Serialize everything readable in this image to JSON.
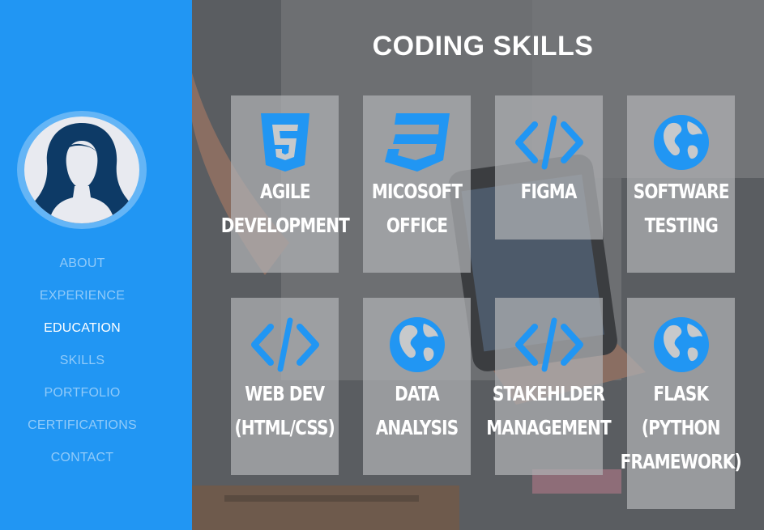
{
  "sidebar": {
    "avatar_alt": "profile avatar",
    "nav": [
      {
        "label": "ABOUT",
        "active": false
      },
      {
        "label": "EXPERIENCE",
        "active": false
      },
      {
        "label": "EDUCATION",
        "active": true
      },
      {
        "label": "SKILLS",
        "active": false
      },
      {
        "label": "PORTFOLIO",
        "active": false
      },
      {
        "label": "CERTIFICATIONS",
        "active": false
      },
      {
        "label": "CONTACT",
        "active": false
      }
    ]
  },
  "main": {
    "title": "CODING SKILLS",
    "skills": [
      {
        "label": "AGILE\nDEVELOPMENT",
        "icon": "html5-icon"
      },
      {
        "label": "MICOSOFT\nOFFICE",
        "icon": "css3-icon"
      },
      {
        "label": "FIGMA",
        "icon": "code-icon"
      },
      {
        "label": "SOFTWARE\nTESTING",
        "icon": "globe-icon"
      },
      {
        "label": "WEB DEV\n(HTML/CSS)",
        "icon": "code-icon"
      },
      {
        "label": "DATA\nANALYSIS",
        "icon": "globe-icon"
      },
      {
        "label": "STAKEHLDER\nMANAGEMENT",
        "icon": "code-icon"
      },
      {
        "label": "FLASK\n(PYTHON\nFRAMEWORK)",
        "icon": "globe-icon"
      }
    ]
  },
  "colors": {
    "sidebar_bg": "#2196f3",
    "nav_inactive": "#90caf9",
    "nav_active": "#ffffff",
    "icon_blue": "#2196f3",
    "card_bg": "rgba(176,178,180,0.72)"
  }
}
